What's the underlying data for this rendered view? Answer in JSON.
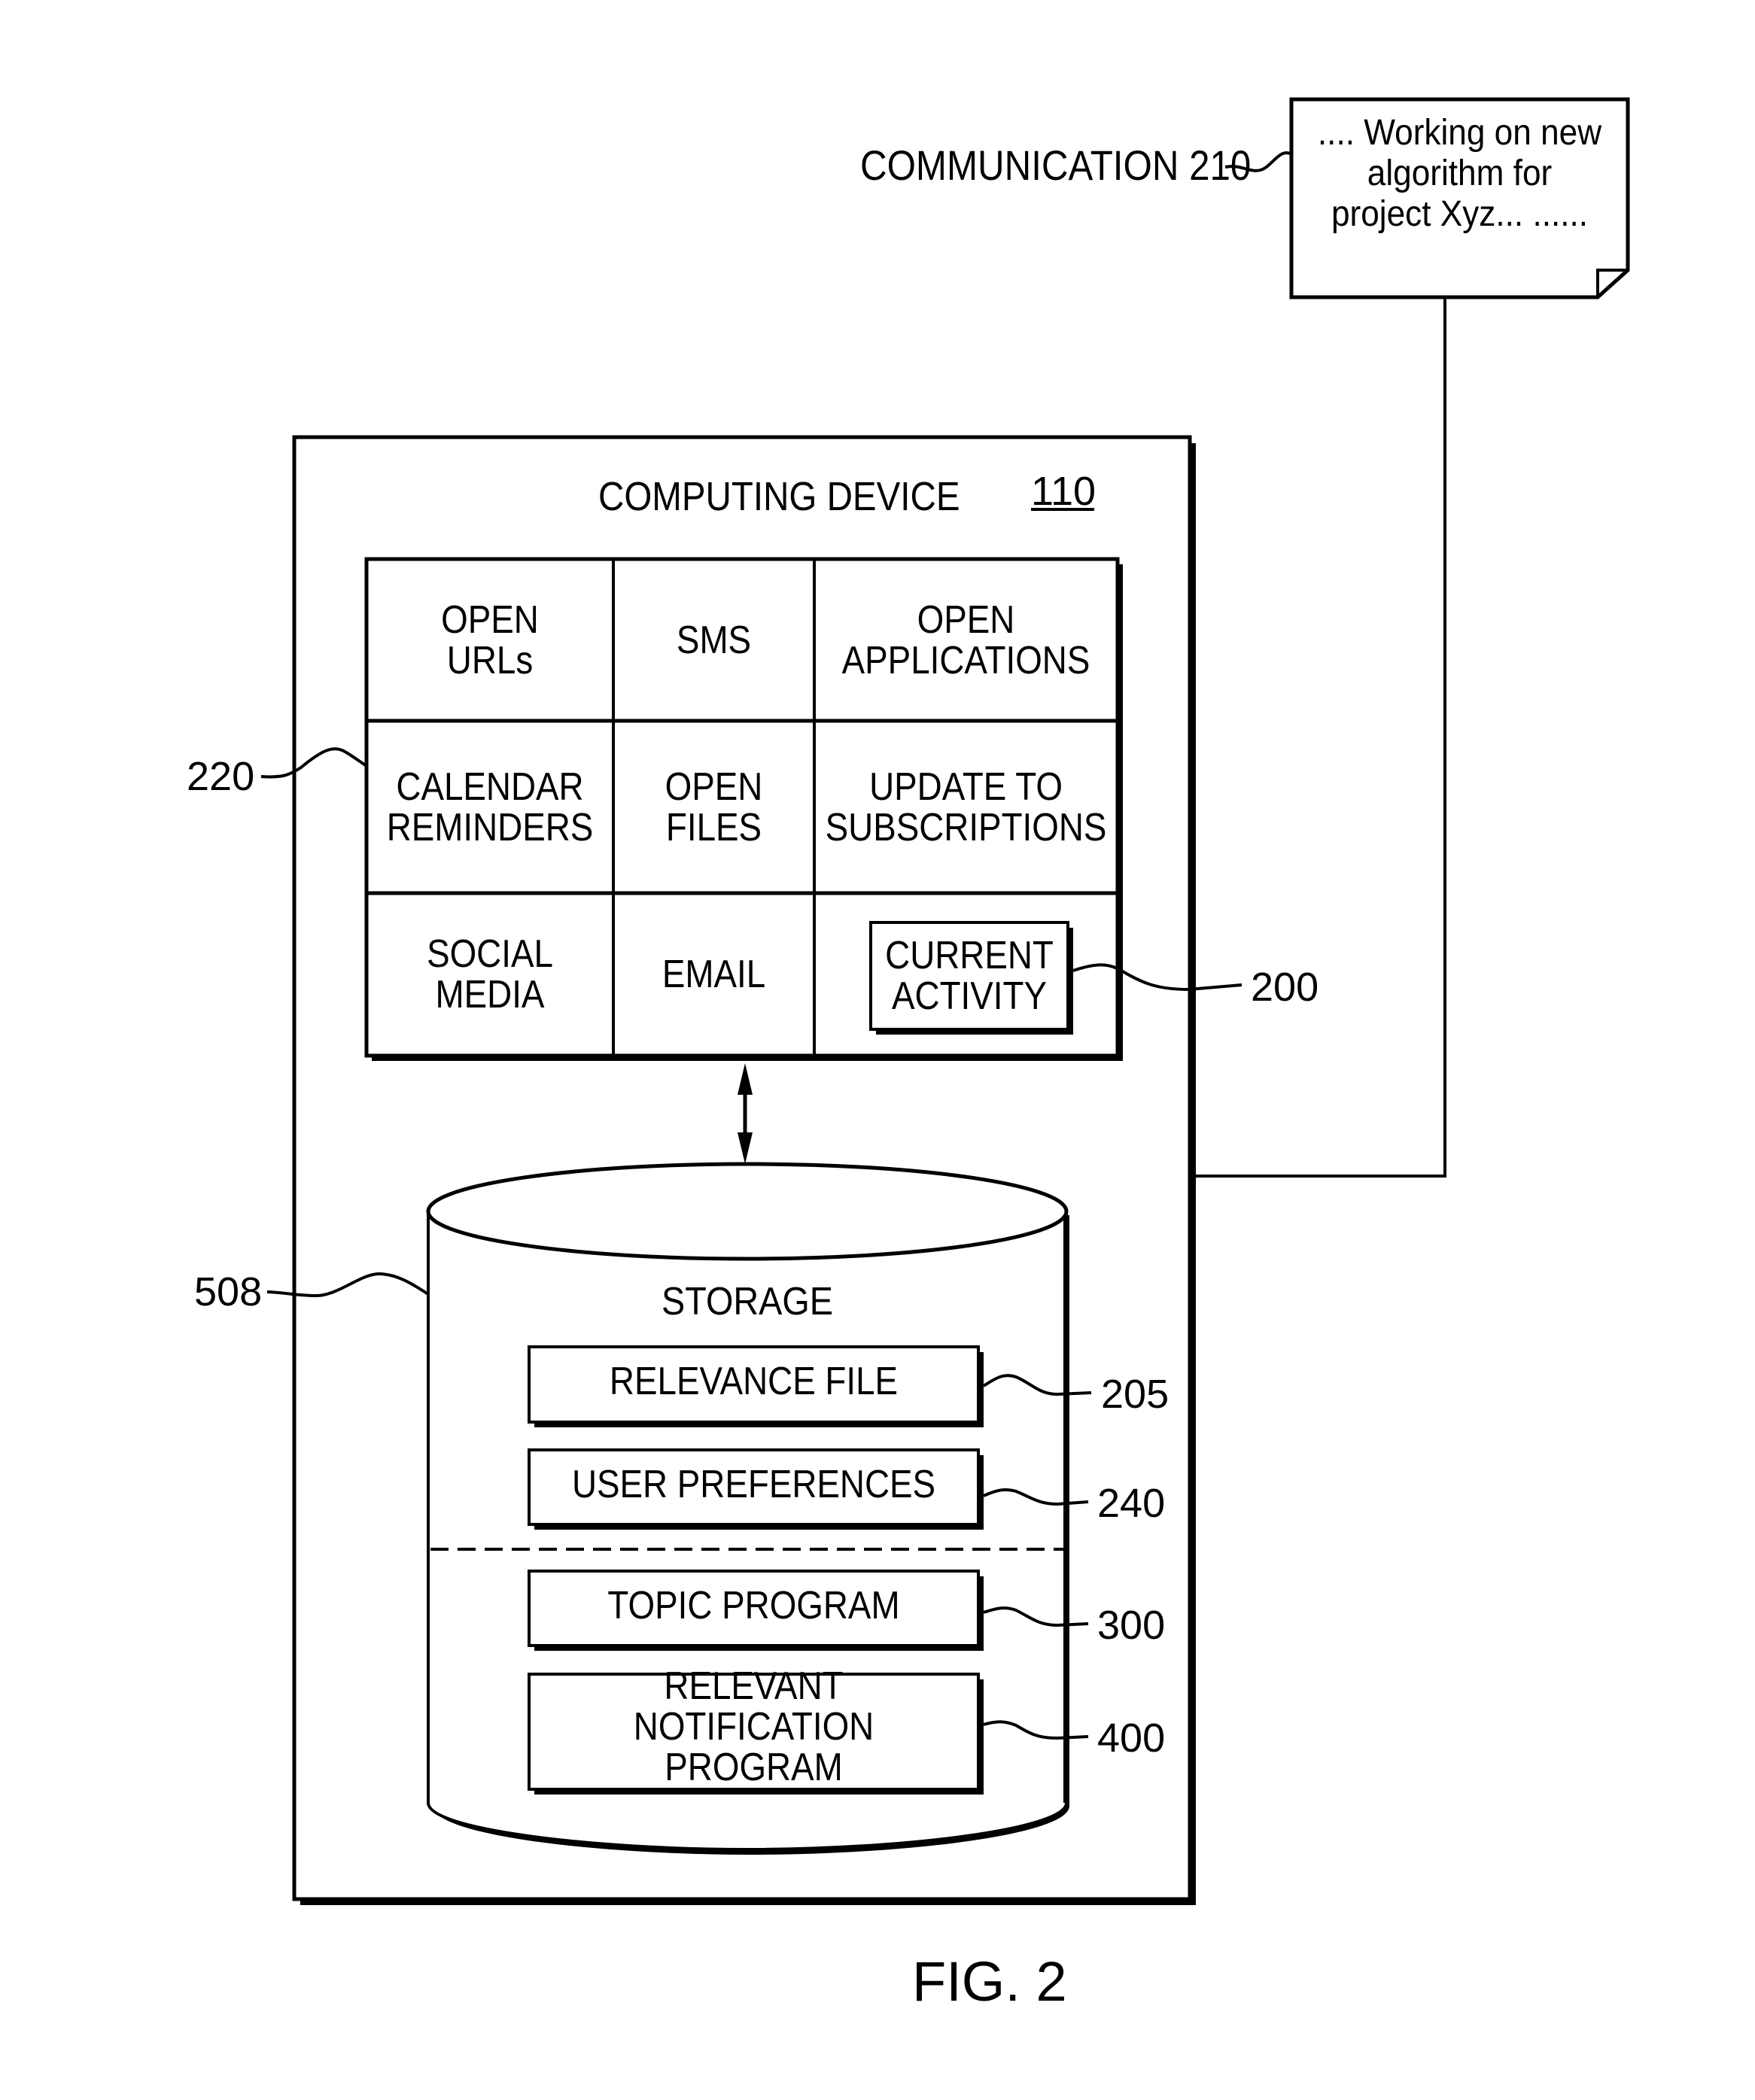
{
  "figure": {
    "caption": "FIG. 2"
  },
  "communication": {
    "label": "COMMUNICATION 210",
    "document_lines": [
      ".... Working on new",
      "algorithm for",
      "project Xyz... ......"
    ]
  },
  "computing_device": {
    "title": "COMPUTING DEVICE",
    "ref": "110",
    "grid_ref": "220",
    "grid": [
      [
        "OPEN",
        "URLs"
      ],
      [
        "SMS"
      ],
      [
        "OPEN",
        "APPLICATIONS"
      ],
      [
        "CALENDAR",
        "REMINDERS"
      ],
      [
        "OPEN",
        "FILES"
      ],
      [
        "UPDATE TO",
        "SUBSCRIPTIONS"
      ],
      [
        "SOCIAL",
        "MEDIA"
      ],
      [
        "EMAIL"
      ],
      [
        "CURRENT",
        "ACTIVITY"
      ]
    ],
    "current_activity_ref": "200"
  },
  "storage": {
    "label": "STORAGE",
    "ref": "508",
    "items": [
      {
        "lines": [
          "RELEVANCE FILE"
        ],
        "ref": "205"
      },
      {
        "lines": [
          "USER PREFERENCES"
        ],
        "ref": "240"
      },
      {
        "lines": [
          "TOPIC PROGRAM"
        ],
        "ref": "300"
      },
      {
        "lines": [
          "RELEVANT NOTIFICATION",
          "PROGRAM"
        ],
        "ref": "400"
      }
    ]
  }
}
